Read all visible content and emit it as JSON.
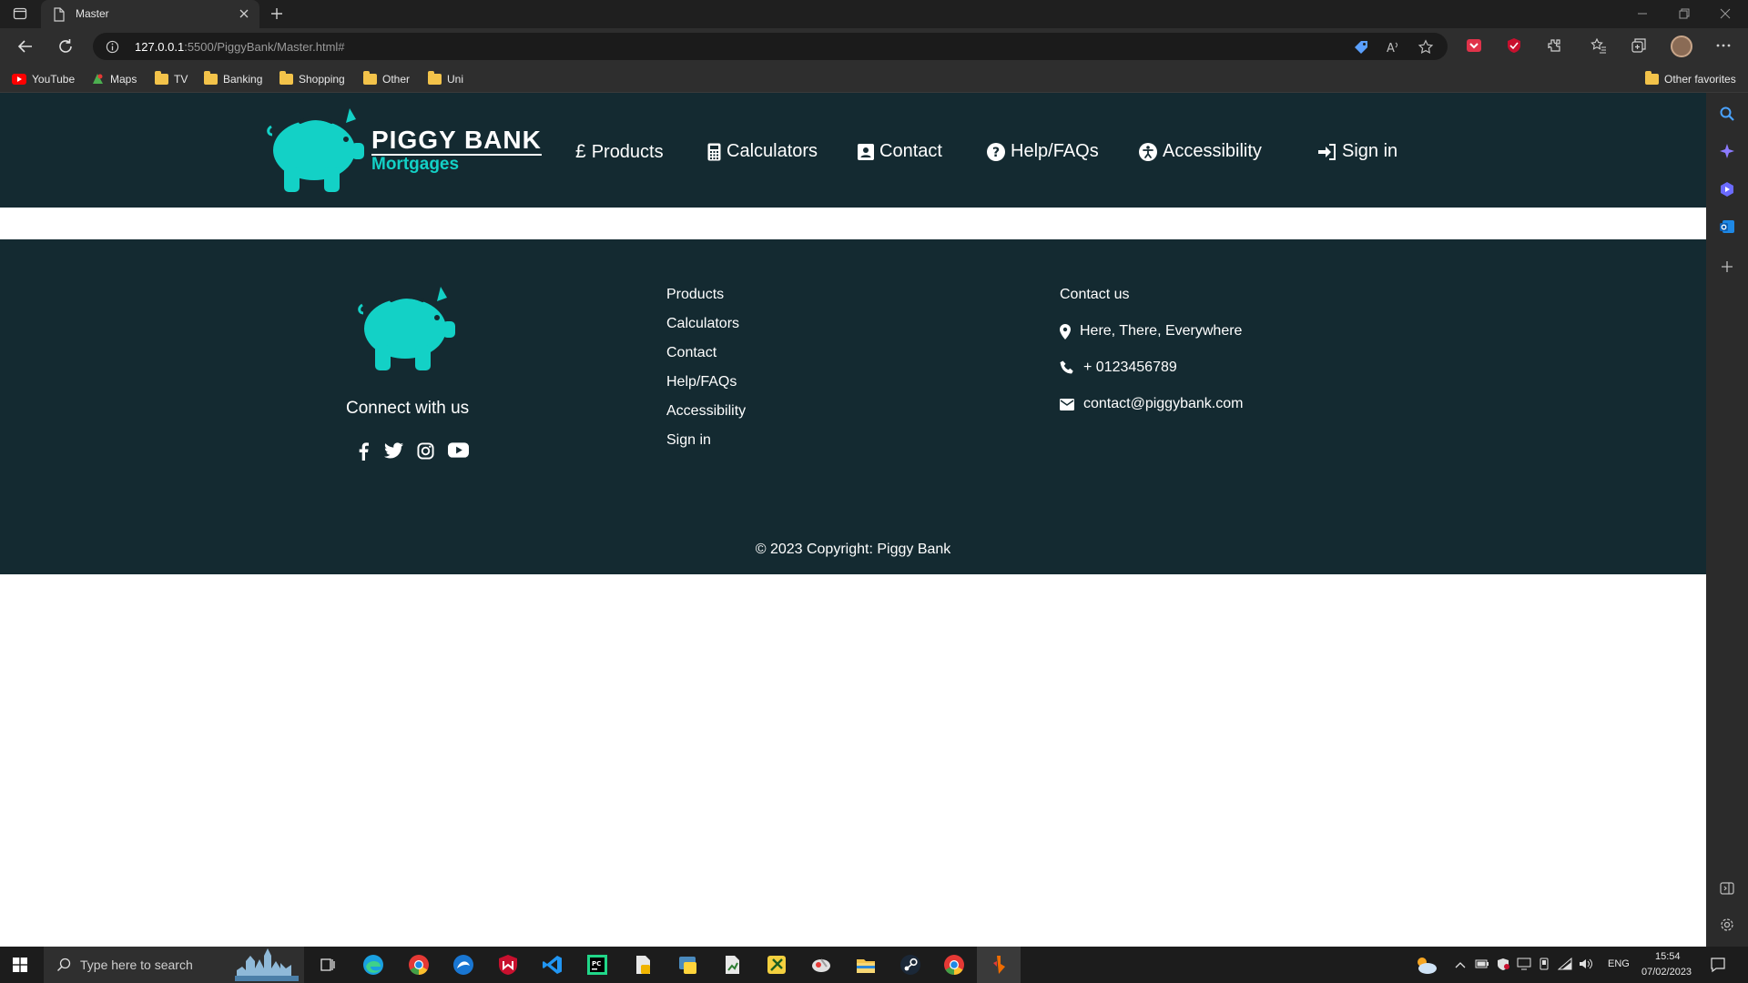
{
  "browser": {
    "tab_title": "Master",
    "url_host": "127.0.0.1",
    "url_rest": ":5500/PiggyBank/Master.html#",
    "bookmarks": [
      "YouTube",
      "Maps",
      "TV",
      "Banking",
      "Shopping",
      "Other",
      "Uni"
    ],
    "other_favorites": "Other favorites"
  },
  "site": {
    "logo_title": "PIGGY BANK",
    "logo_subtitle": "Mortgages",
    "nav": {
      "products": "Products",
      "calculators": "Calculators",
      "contact": "Contact",
      "help": "Help/FAQs",
      "accessibility": "Accessibility",
      "signin": "Sign in"
    },
    "colors": {
      "header_bg": "#142a31",
      "accent": "#13d1c6"
    }
  },
  "footer": {
    "connect": "Connect with us",
    "links": [
      "Products",
      "Calculators",
      "Contact",
      "Help/FAQs",
      "Accessibility",
      "Sign in"
    ],
    "contact_title": "Contact us",
    "address": "Here, There, Everywhere",
    "phone": "+ 0123456789",
    "email": "contact@piggybank.com",
    "copyright": "© 2023 Copyright: Piggy Bank"
  },
  "taskbar": {
    "search_placeholder": "Type here to search",
    "language": "ENG",
    "time": "15:54",
    "date": "07/02/2023"
  }
}
